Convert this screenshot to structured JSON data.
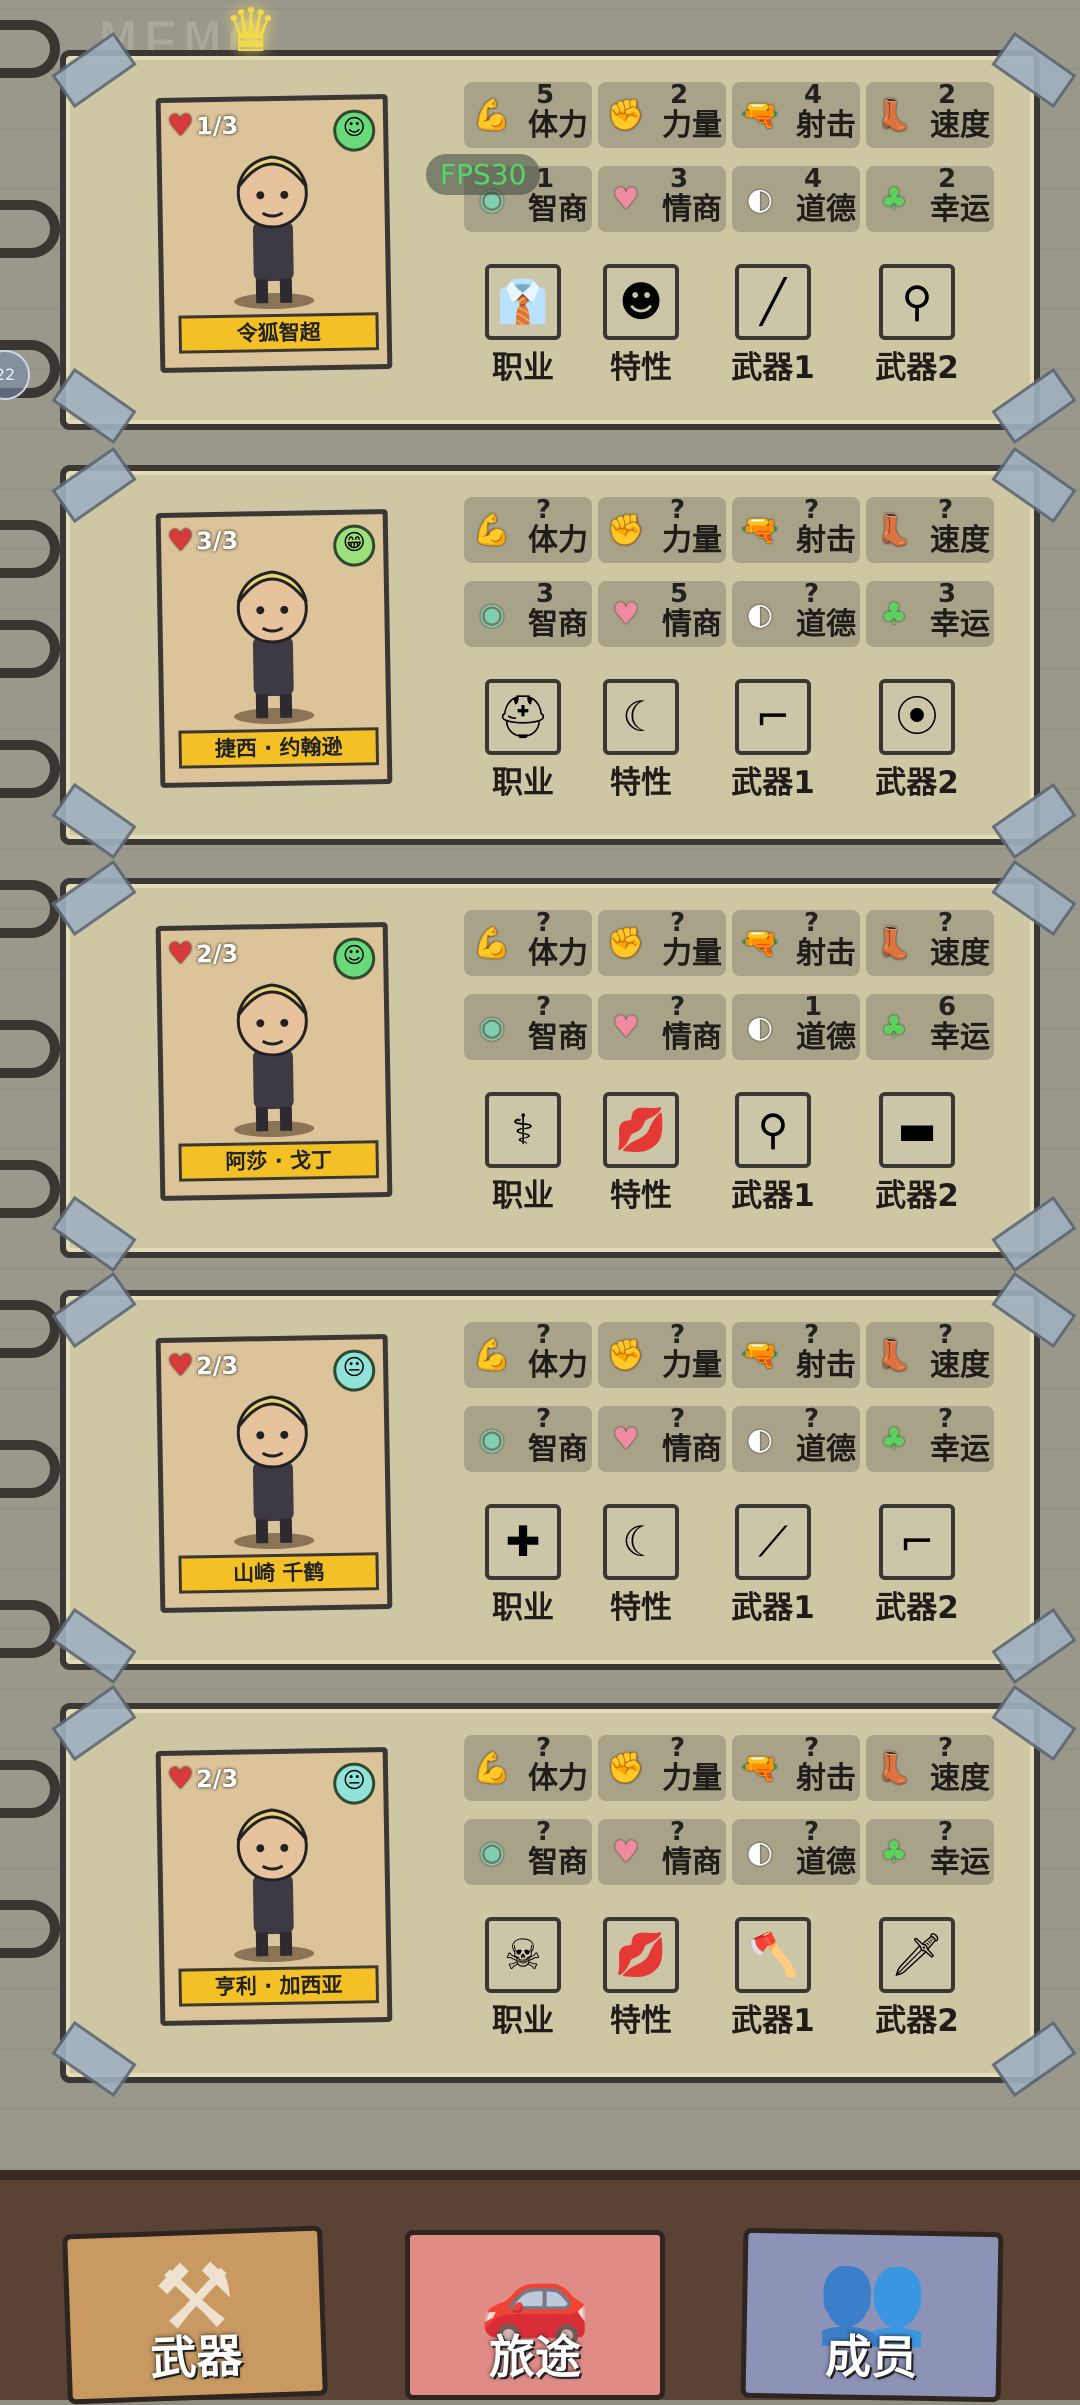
{
  "overlay": {
    "fps": "FPS30",
    "side_bubble": "22"
  },
  "memo_title": "MEMO",
  "stat_labels": [
    "体力",
    "力量",
    "射击",
    "速度",
    "智商",
    "情商",
    "道德",
    "幸运"
  ],
  "stat_icons": [
    "flex-icon",
    "fist-arm-icon",
    "revolver-icon",
    "boot-wing-icon",
    "brain-icon",
    "heart-face-icon",
    "mask-icon",
    "clover-icon"
  ],
  "item_labels": [
    "职业",
    "特性",
    "武器1",
    "武器2"
  ],
  "characters": [
    {
      "name": "令狐智超",
      "hp": "1/3",
      "mood": "happy",
      "crowned": true,
      "stats": [
        "5",
        "2",
        "4",
        "2",
        "1",
        "3",
        "4",
        "2"
      ],
      "items": [
        {
          "icon": "businessman-icon"
        },
        {
          "icon": "trait-portrait-icon"
        },
        {
          "icon": "bat-weapon-icon"
        },
        {
          "icon": "shovel-icon"
        }
      ]
    },
    {
      "name": "捷西 · 约翰逊",
      "hp": "3/3",
      "mood": "grin",
      "crowned": false,
      "stats": [
        "?",
        "?",
        "?",
        "?",
        "3",
        "5",
        "?",
        "3"
      ],
      "items": [
        {
          "icon": "worker-icon"
        },
        {
          "icon": "sleeping-trait-icon"
        },
        {
          "icon": "crowbar-icon"
        },
        {
          "icon": "frying-pan-icon"
        }
      ]
    },
    {
      "name": "阿莎 · 戈丁",
      "hp": "2/3",
      "mood": "smile",
      "crowned": false,
      "stats": [
        "?",
        "?",
        "?",
        "?",
        "?",
        "?",
        "1",
        "6"
      ],
      "items": [
        {
          "icon": "doctor-icon"
        },
        {
          "icon": "lips-icon"
        },
        {
          "icon": "shovel-icon"
        },
        {
          "icon": "plank-icon"
        }
      ]
    },
    {
      "name": "山崎 千鹤",
      "hp": "2/3",
      "mood": "neutral",
      "crowned": false,
      "stats": [
        "?",
        "?",
        "?",
        "?",
        "?",
        "?",
        "?",
        "?"
      ],
      "items": [
        {
          "icon": "nurse-icon"
        },
        {
          "icon": "sleeping-trait-icon"
        },
        {
          "icon": "rolling-pin-icon"
        },
        {
          "icon": "crowbar-icon"
        }
      ]
    },
    {
      "name": "亨利 · 加西亚",
      "hp": "2/3",
      "mood": "neutral",
      "crowned": false,
      "stats": [
        "?",
        "?",
        "?",
        "?",
        "?",
        "?",
        "?",
        "?"
      ],
      "items": [
        {
          "icon": "ninja-icon"
        },
        {
          "icon": "lips-icon"
        },
        {
          "icon": "axe-icon"
        },
        {
          "icon": "sword-icon"
        }
      ]
    }
  ],
  "nav": [
    {
      "label": "武器",
      "icon": "weapons-icon",
      "color": "#c89a62"
    },
    {
      "label": "旅途",
      "icon": "car-icon",
      "color": "#e08b86"
    },
    {
      "label": "成员",
      "icon": "members-icon",
      "color": "#8d93b6"
    }
  ],
  "stat_colors": [
    "#e8b23a",
    "#e58aa0",
    "#8a6a52",
    "#9fb5c4",
    "#7ed0b0",
    "#f08aa0",
    "#ffffff",
    "#5fcf5f"
  ]
}
